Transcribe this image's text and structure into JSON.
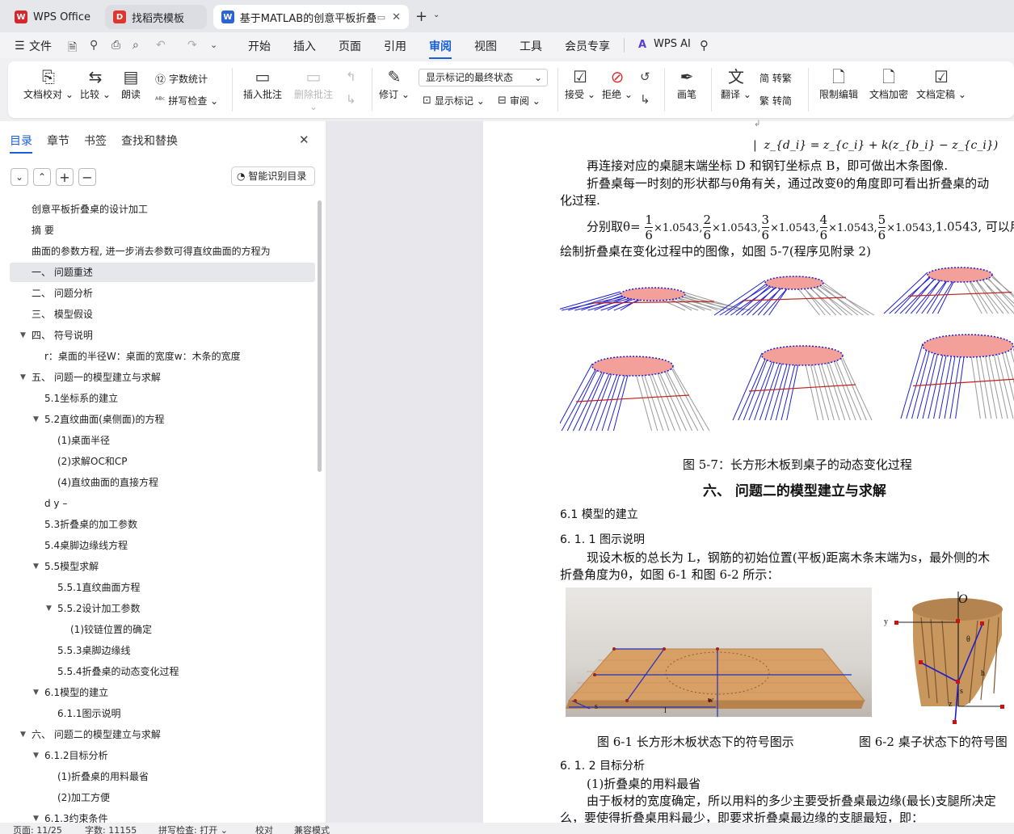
{
  "tabs": [
    {
      "label": "WPS Office"
    },
    {
      "label": "找稻壳模板"
    },
    {
      "label": "基于MATLAB的创意平板折叠"
    }
  ],
  "menubar": {
    "file": "文件",
    "items": [
      "开始",
      "插入",
      "页面",
      "引用",
      "审阅",
      "视图",
      "工具",
      "会员专享"
    ],
    "active": "审阅",
    "ai": "WPS AI"
  },
  "ribbon": {
    "doc_check": "文档校对",
    "compare": "比较",
    "read_aloud": "朗读",
    "word_count": "字数统计",
    "spell_check": "拼写检查",
    "insert_comment": "插入批注",
    "delete_comment": "删除批注",
    "revise": "修订",
    "markup_state": "显示标记的最终状态",
    "show_markup": "显示标记",
    "review": "审阅",
    "accept": "接受",
    "reject": "拒绝",
    "pen": "画笔",
    "translate": "翻译",
    "to_traditional": "简 转繁",
    "to_simplified": "繁 转简",
    "restrict_edit": "限制编辑",
    "encrypt": "文档加密",
    "finalize": "文档定稿"
  },
  "nav": {
    "tabs": [
      "目录",
      "章节",
      "书签",
      "查找和替换"
    ],
    "smart_toc": "智能识别目录",
    "items": [
      {
        "label": "创意平板折叠桌的设计加工",
        "level": 0
      },
      {
        "label": "摘  要",
        "level": 0
      },
      {
        "label": "曲面的参数方程, 进一步消去参数可得直纹曲面的方程为",
        "level": 0
      },
      {
        "label": "一、  问题重述",
        "level": 0,
        "selected": true
      },
      {
        "label": "二、  问题分析",
        "level": 0
      },
      {
        "label": "三、  模型假设",
        "level": 0
      },
      {
        "label": "四、  符号说明",
        "level": 0,
        "caret": true
      },
      {
        "label": "r：桌面的半径W：桌面的宽度w：木条的宽度",
        "level": 1
      },
      {
        "label": "五、  问题一的模型建立与求解",
        "level": 0,
        "caret": true
      },
      {
        "label": "5.1坐标系的建立",
        "level": 1
      },
      {
        "label": "5.2直纹曲面(桌侧面)的方程",
        "level": 1,
        "caret": true
      },
      {
        "label": "(1)桌面半径",
        "level": 2
      },
      {
        "label": "(2)求解OC和CP",
        "level": 2
      },
      {
        "label": "(4)直纹曲面的直接方程",
        "level": 2
      },
      {
        "label": "d y –",
        "level": 1
      },
      {
        "label": "5.3折叠桌的加工参数",
        "level": 1
      },
      {
        "label": "5.4桌脚边缘线方程",
        "level": 1
      },
      {
        "label": "5.5模型求解",
        "level": 1,
        "caret": true
      },
      {
        "label": "5.5.1直纹曲面方程",
        "level": 2
      },
      {
        "label": "5.5.2设计加工参数",
        "level": 2,
        "caret": true
      },
      {
        "label": "(1)铰链位置的确定",
        "level": 3
      },
      {
        "label": "5.5.3桌脚边缘线",
        "level": 2
      },
      {
        "label": "5.5.4折叠桌的动态变化过程",
        "level": 2
      },
      {
        "label": "6.1模型的建立",
        "level": 1,
        "caret": true
      },
      {
        "label": "6.1.1图示说明",
        "level": 2
      },
      {
        "label": "六、  问题二的模型建立与求解",
        "level": 0,
        "caret": true
      },
      {
        "label": "6.1.2目标分析",
        "level": 1,
        "caret": true
      },
      {
        "label": "(1)折叠桌的用料最省",
        "level": 2
      },
      {
        "label": "(2)加工方便",
        "level": 2
      },
      {
        "label": "6.1.3约束条件",
        "level": 1,
        "caret": true
      }
    ]
  },
  "doc": {
    "formula_top": "z_{d_i} = z_{c_i} + k(z_{b_i} − z_{c_i})",
    "p1": "再连接对应的桌腿末端坐标  D 和钢钉坐标点  B，即可做出木条图像.",
    "p2a": "折叠桌每一时刻的形状都与θ角有关，通过改变θ的角度即可看出折叠桌的动",
    "p2b": "化过程.",
    "p3a": "分别取θ=",
    "p3_fracs": [
      "1",
      "2",
      "3",
      "4",
      "5"
    ],
    "p3_den": "6",
    "p3_mult": "×1.0543,",
    "p3_end": "1.0543, 可以用",
    "p3b": "绘制折叠桌在变化过程中的图像，如图  5-7(程序见附录  2)",
    "fig57_caption": "图  5-7：长方形木板到桌子的动态变化过程",
    "h6": "六、   问题二的模型建立与求解",
    "s61": "6.1  模型的建立",
    "s611": "6. 1. 1 图示说明",
    "p4a": "现设木板的总长为  L，钢筋的初始位置(平板)距离木条末端为s，最外侧的木",
    "p4b": "折叠角度为θ，如图  6-1  和图  6-2  所示：",
    "fig61_caption": "图 6-1   长方形木板状态下的符号图示",
    "fig62_caption": "图 6-2  桌子状态下的符号图",
    "s612": "6. 1. 2 目标分析",
    "p5": "(1)折叠桌的用料最省",
    "p6a": "由于板材的宽度确定，所以用料的多少主要受折叠桌最边缘(最长)支腿所决定",
    "p6b": "么，要使得折叠桌用料最少，即要求折叠桌最边缘的支腿最短，即："
  },
  "status": {
    "page": "页面: 11/25",
    "words": "字数: 11155",
    "spell": "拼写检查: 打开",
    "proof": "校对",
    "compat": "兼容模式"
  },
  "colors": {
    "accent": "#1a5fd8",
    "wps_red": "#d7262c",
    "table_pink": "#f4a09a",
    "leg_blue": "#2020d0"
  }
}
